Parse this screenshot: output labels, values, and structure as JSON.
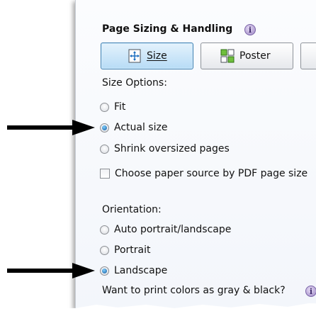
{
  "section": {
    "title": "Page Sizing & Handling",
    "info_glyph": "i"
  },
  "toolbar": {
    "size_label": "Size",
    "poster_label": "Poster",
    "size_selected": true
  },
  "size_options": {
    "label": "Size Options:",
    "items": [
      {
        "label": "Fit",
        "checked": false
      },
      {
        "label": "Actual size",
        "checked": true
      },
      {
        "label": "Shrink oversized pages",
        "checked": false
      }
    ],
    "paper_source_label": "Choose paper source by PDF page size",
    "paper_source_checked": false
  },
  "orientation": {
    "label": "Orientation:",
    "items": [
      {
        "label": "Auto portrait/landscape",
        "checked": false
      },
      {
        "label": "Portrait",
        "checked": false
      },
      {
        "label": "Landscape",
        "checked": true
      }
    ]
  },
  "gray_print": {
    "question": "Want to print colors as gray & black?",
    "info_glyph": "i"
  },
  "annotations": {
    "arrow_color": "#000000",
    "arrow_targets": [
      "Actual size",
      "Landscape"
    ]
  },
  "colors": {
    "selected_button_border": "#3c7fb1",
    "selected_button_fill": "#b7dcf6",
    "info_icon": "#9c86c4"
  }
}
